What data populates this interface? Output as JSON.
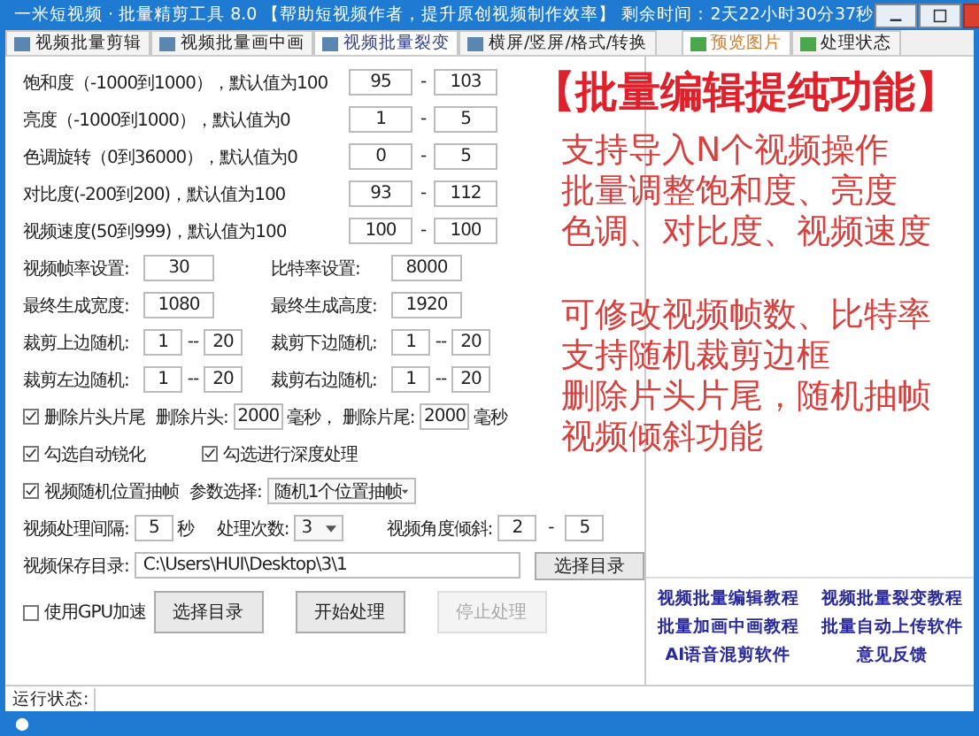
{
  "window": {
    "title": "一米短视频 · 批量精剪工具 8.0 【帮助短视频作者，提升原创视频制作效率】 剩余时间：2天22小时30分37秒"
  },
  "tabs": [
    {
      "label": "视频批量剪辑",
      "selected": false
    },
    {
      "label": "视频批量画中画",
      "selected": false
    },
    {
      "label": "视频批量裂变",
      "selected": true
    },
    {
      "label": "横屏/竖屏/格式/转换",
      "selected": false
    }
  ],
  "preview_tabs": [
    {
      "label": "预览图片",
      "selected": true
    },
    {
      "label": "处理状态",
      "selected": false
    }
  ],
  "range_settings": [
    {
      "label": "饱和度（-1000到1000），默认值为100",
      "from": "95",
      "separator": "-",
      "to": "103"
    },
    {
      "label": "亮度（-1000到1000），默认值为0",
      "from": "1",
      "separator": "-",
      "to": "5"
    },
    {
      "label": "色调旋转（0到36000），默认值为0",
      "from": "0",
      "separator": "-",
      "to": "5"
    },
    {
      "label": "对比度(-200到200)，默认值为100",
      "from": "93",
      "separator": "-",
      "to": "112"
    },
    {
      "label": "视频速度(50到999)，默认值为100",
      "from": "100",
      "separator": "-",
      "to": "100"
    }
  ],
  "paired_settings": [
    {
      "kind": "single",
      "items": [
        {
          "label": "视频帧率设置:",
          "value": "30"
        },
        {
          "label": "比特率设置:",
          "value": "8000"
        }
      ]
    },
    {
      "kind": "single",
      "items": [
        {
          "label": "最终生成宽度:",
          "value": "1080"
        },
        {
          "label": "最终生成高度:",
          "value": "1920"
        }
      ]
    },
    {
      "kind": "range",
      "items": [
        {
          "label": "裁剪上边随机:",
          "from": "1",
          "separator": "--",
          "to": "20"
        },
        {
          "label": "裁剪下边随机:",
          "from": "1",
          "separator": "--",
          "to": "20"
        }
      ]
    },
    {
      "kind": "range",
      "items": [
        {
          "label": "裁剪左边随机:",
          "from": "1",
          "separator": "--",
          "to": "20"
        },
        {
          "label": "裁剪右边随机:",
          "from": "1",
          "separator": "--",
          "to": "20"
        }
      ]
    }
  ],
  "trim": {
    "label": "删除片头片尾",
    "checked": true,
    "head_label": "删除片头:",
    "head_value": "2000",
    "head_unit": "毫秒，",
    "tail_label": "删除片尾:",
    "tail_value": "2000",
    "tail_unit": "毫秒"
  },
  "options": [
    {
      "label": "勾选自动锐化",
      "checked": true
    },
    {
      "label": "勾选进行深度处理",
      "checked": true
    }
  ],
  "frame_extract": {
    "label": "视频随机位置抽帧",
    "checked": true,
    "param_label": "参数选择:",
    "param_value": "随机1个位置抽帧"
  },
  "interval": {
    "label": "视频处理间隔:",
    "value": "5",
    "unit": "秒",
    "count_label": "处理次数:",
    "count_value": "3",
    "tilt_label": "视频角度倾斜:",
    "tilt_from": "2",
    "tilt_separator": "-",
    "tilt_to": "5"
  },
  "save_dir": {
    "label": "视频保存目录:",
    "value": "C:\\Users\\HUI\\Desktop\\3\\1",
    "button": "选择目录"
  },
  "gpu": {
    "label": "使用GPU加速",
    "checked": false
  },
  "buttons": [
    {
      "label": "选择目录",
      "disabled": false
    },
    {
      "label": "开始处理",
      "disabled": false
    },
    {
      "label": "停止处理",
      "disabled": true
    }
  ],
  "links": [
    "视频批量编辑教程",
    "视频批量裂变教程",
    "批量加画中画教程",
    "批量自动上传软件",
    "AI语音混剪软件",
    "意见反馈"
  ],
  "overlay": {
    "title": "【批量编辑提纯功能】",
    "groups": [
      [
        "支持导入N个视频操作",
        "批量调整饱和度、亮度",
        "色调、对比度、视频速度"
      ],
      [
        "可修改视频帧数、比特率",
        "支持随机裁剪边框",
        "删除片头片尾，随机抽帧",
        "视频倾斜功能"
      ]
    ]
  },
  "status_bar": {
    "label": "运行状态:"
  }
}
